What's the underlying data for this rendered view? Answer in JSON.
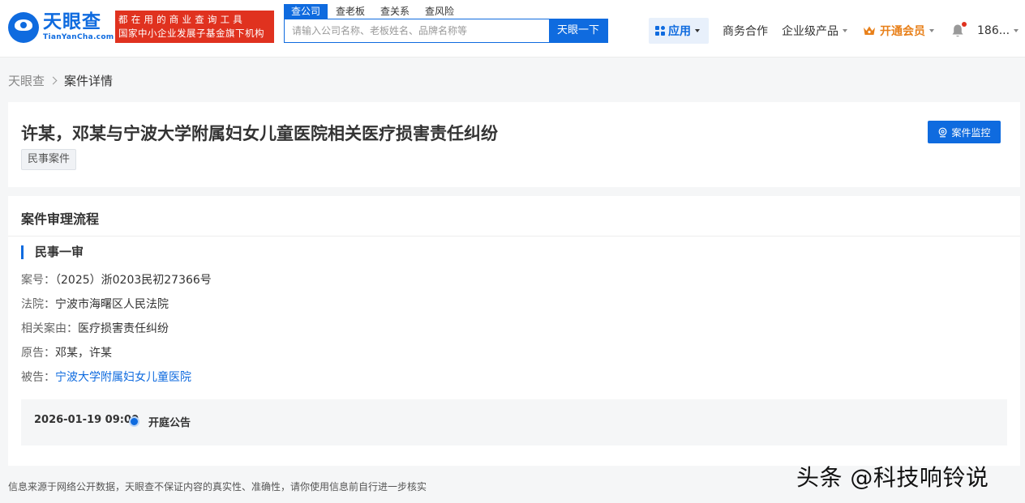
{
  "brand": {
    "name": "天眼查",
    "domain": "TianYanCha.com",
    "slogan_line1": "都在用的商业查询工具",
    "slogan_line2": "国家中小企业发展子基金旗下机构"
  },
  "search": {
    "tabs": [
      "查公司",
      "查老板",
      "查关系",
      "查风险"
    ],
    "placeholder": "请输入公司名称、老板姓名、品牌名称等",
    "button": "天眼一下"
  },
  "nav": {
    "apps": "应用",
    "business": "商务合作",
    "enterprise": "企业级产品",
    "vip": "开通会员",
    "user": "186..."
  },
  "breadcrumb": {
    "home": "天眼查",
    "current": "案件详情"
  },
  "case": {
    "title": "许某，邓某与宁波大学附属妇女儿童医院相关医疗损害责任纠纷",
    "tag": "民事案件",
    "monitor_button": "案件监控"
  },
  "process": {
    "section_title": "案件审理流程",
    "stage": "民事一审",
    "fields": {
      "case_no_label": "案号：",
      "case_no": "（2025）浙0203民初27366号",
      "court_label": "法院：",
      "court": "宁波市海曙区人民法院",
      "cause_label": "相关案由：",
      "cause": "医疗损害责任纠纷",
      "plaintiff_label": "原告：",
      "plaintiff": "邓某，许某",
      "defendant_label": "被告：",
      "defendant": "宁波大学附属妇女儿童医院"
    },
    "timeline": {
      "date": "2026-01-19 09:00",
      "event": "开庭公告"
    }
  },
  "footer": {
    "disclaimer": "信息来源于网络公开数据，天眼查不保证内容的真实性、准确性，请你使用信息前自行进一步核实"
  },
  "watermark": "头条 @科技响铃说",
  "colors": {
    "primary": "#0f6bdf",
    "slogan_bg": "#e0321f",
    "vip": "#e8801a"
  }
}
